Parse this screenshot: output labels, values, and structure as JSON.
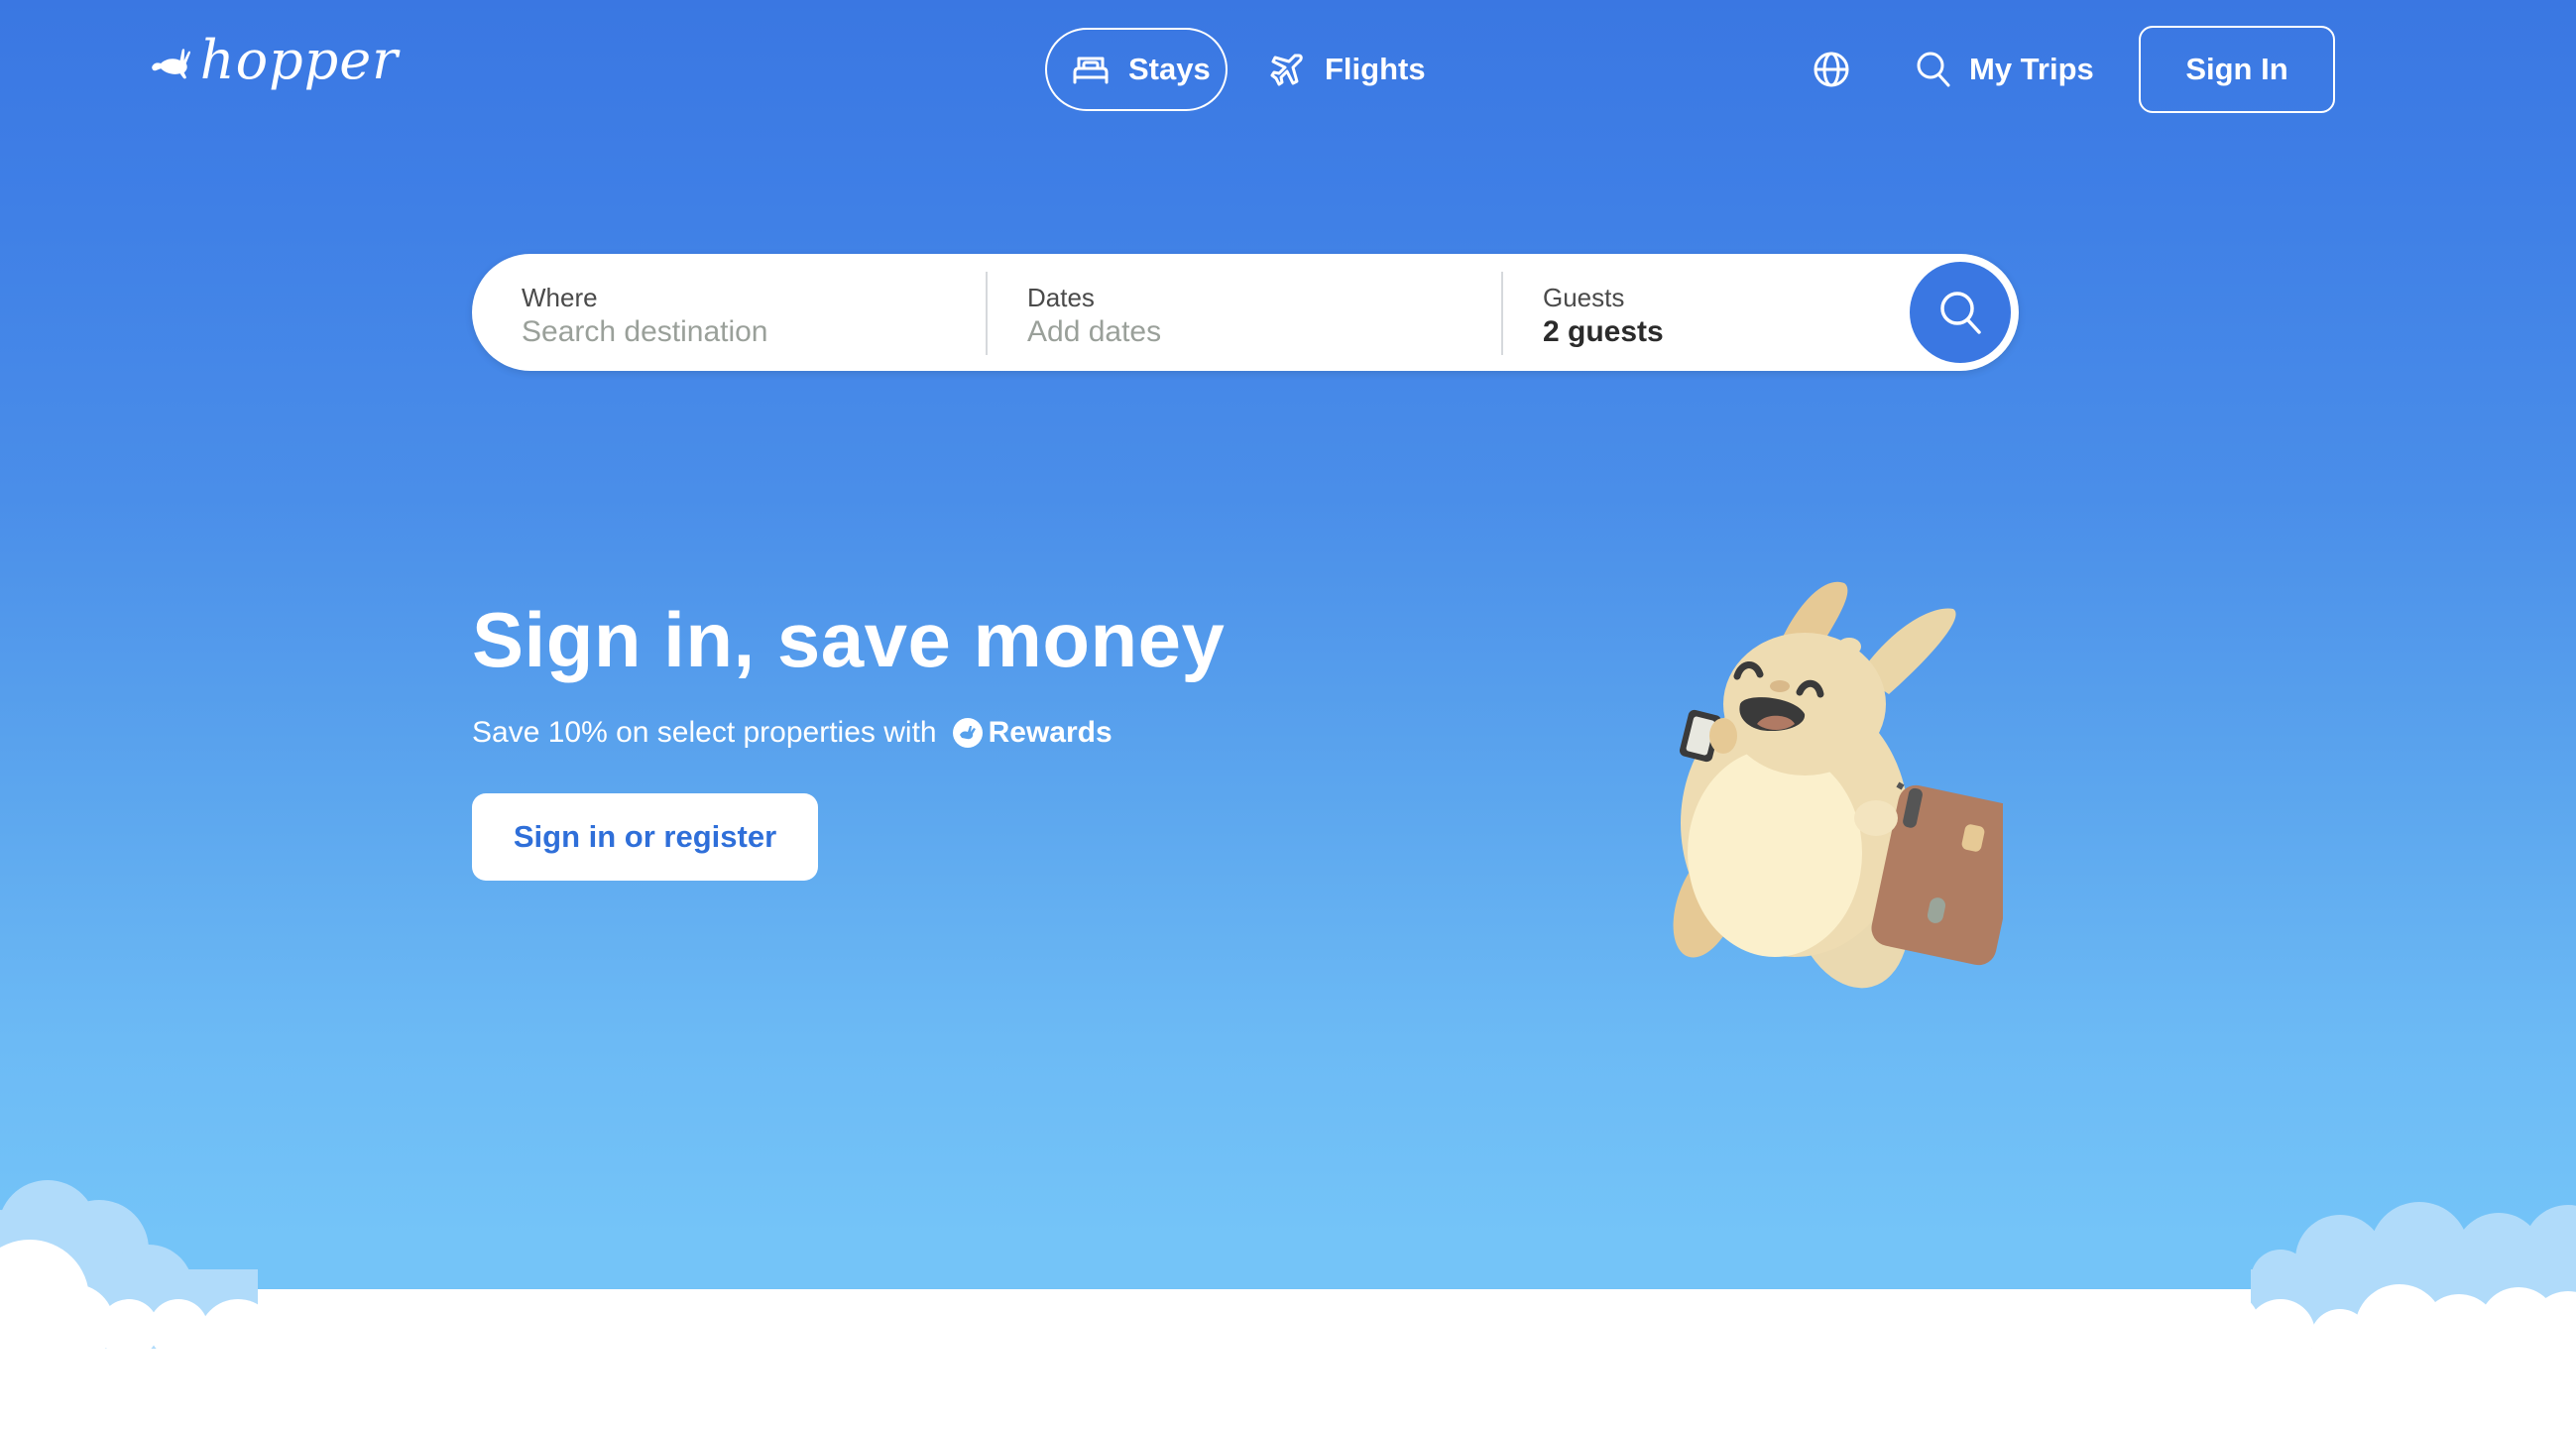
{
  "brand": {
    "name": "hopper",
    "primary_color": "#3a77e2",
    "accent_text_color": "#2f6fd9"
  },
  "header": {
    "tabs": [
      {
        "label": "Stays",
        "icon": "bed-icon",
        "active": true
      },
      {
        "label": "Flights",
        "icon": "airplane-icon",
        "active": false
      }
    ],
    "language_icon": "globe-icon",
    "my_trips": {
      "label": "My Trips",
      "icon": "search-icon"
    },
    "sign_in_label": "Sign In"
  },
  "search": {
    "where": {
      "label": "Where",
      "placeholder": "Search destination",
      "value": ""
    },
    "dates": {
      "label": "Dates",
      "placeholder": "Add dates",
      "value": ""
    },
    "guests": {
      "label": "Guests",
      "value": "2 guests"
    },
    "submit_icon": "search-icon"
  },
  "promo": {
    "title": "Sign in, save money",
    "subtitle": "Save 10% on select properties with",
    "rewards_label": "Rewards",
    "cta_label": "Sign in or register",
    "illustration": "bunny-mascot-with-phone-and-suitcase"
  }
}
